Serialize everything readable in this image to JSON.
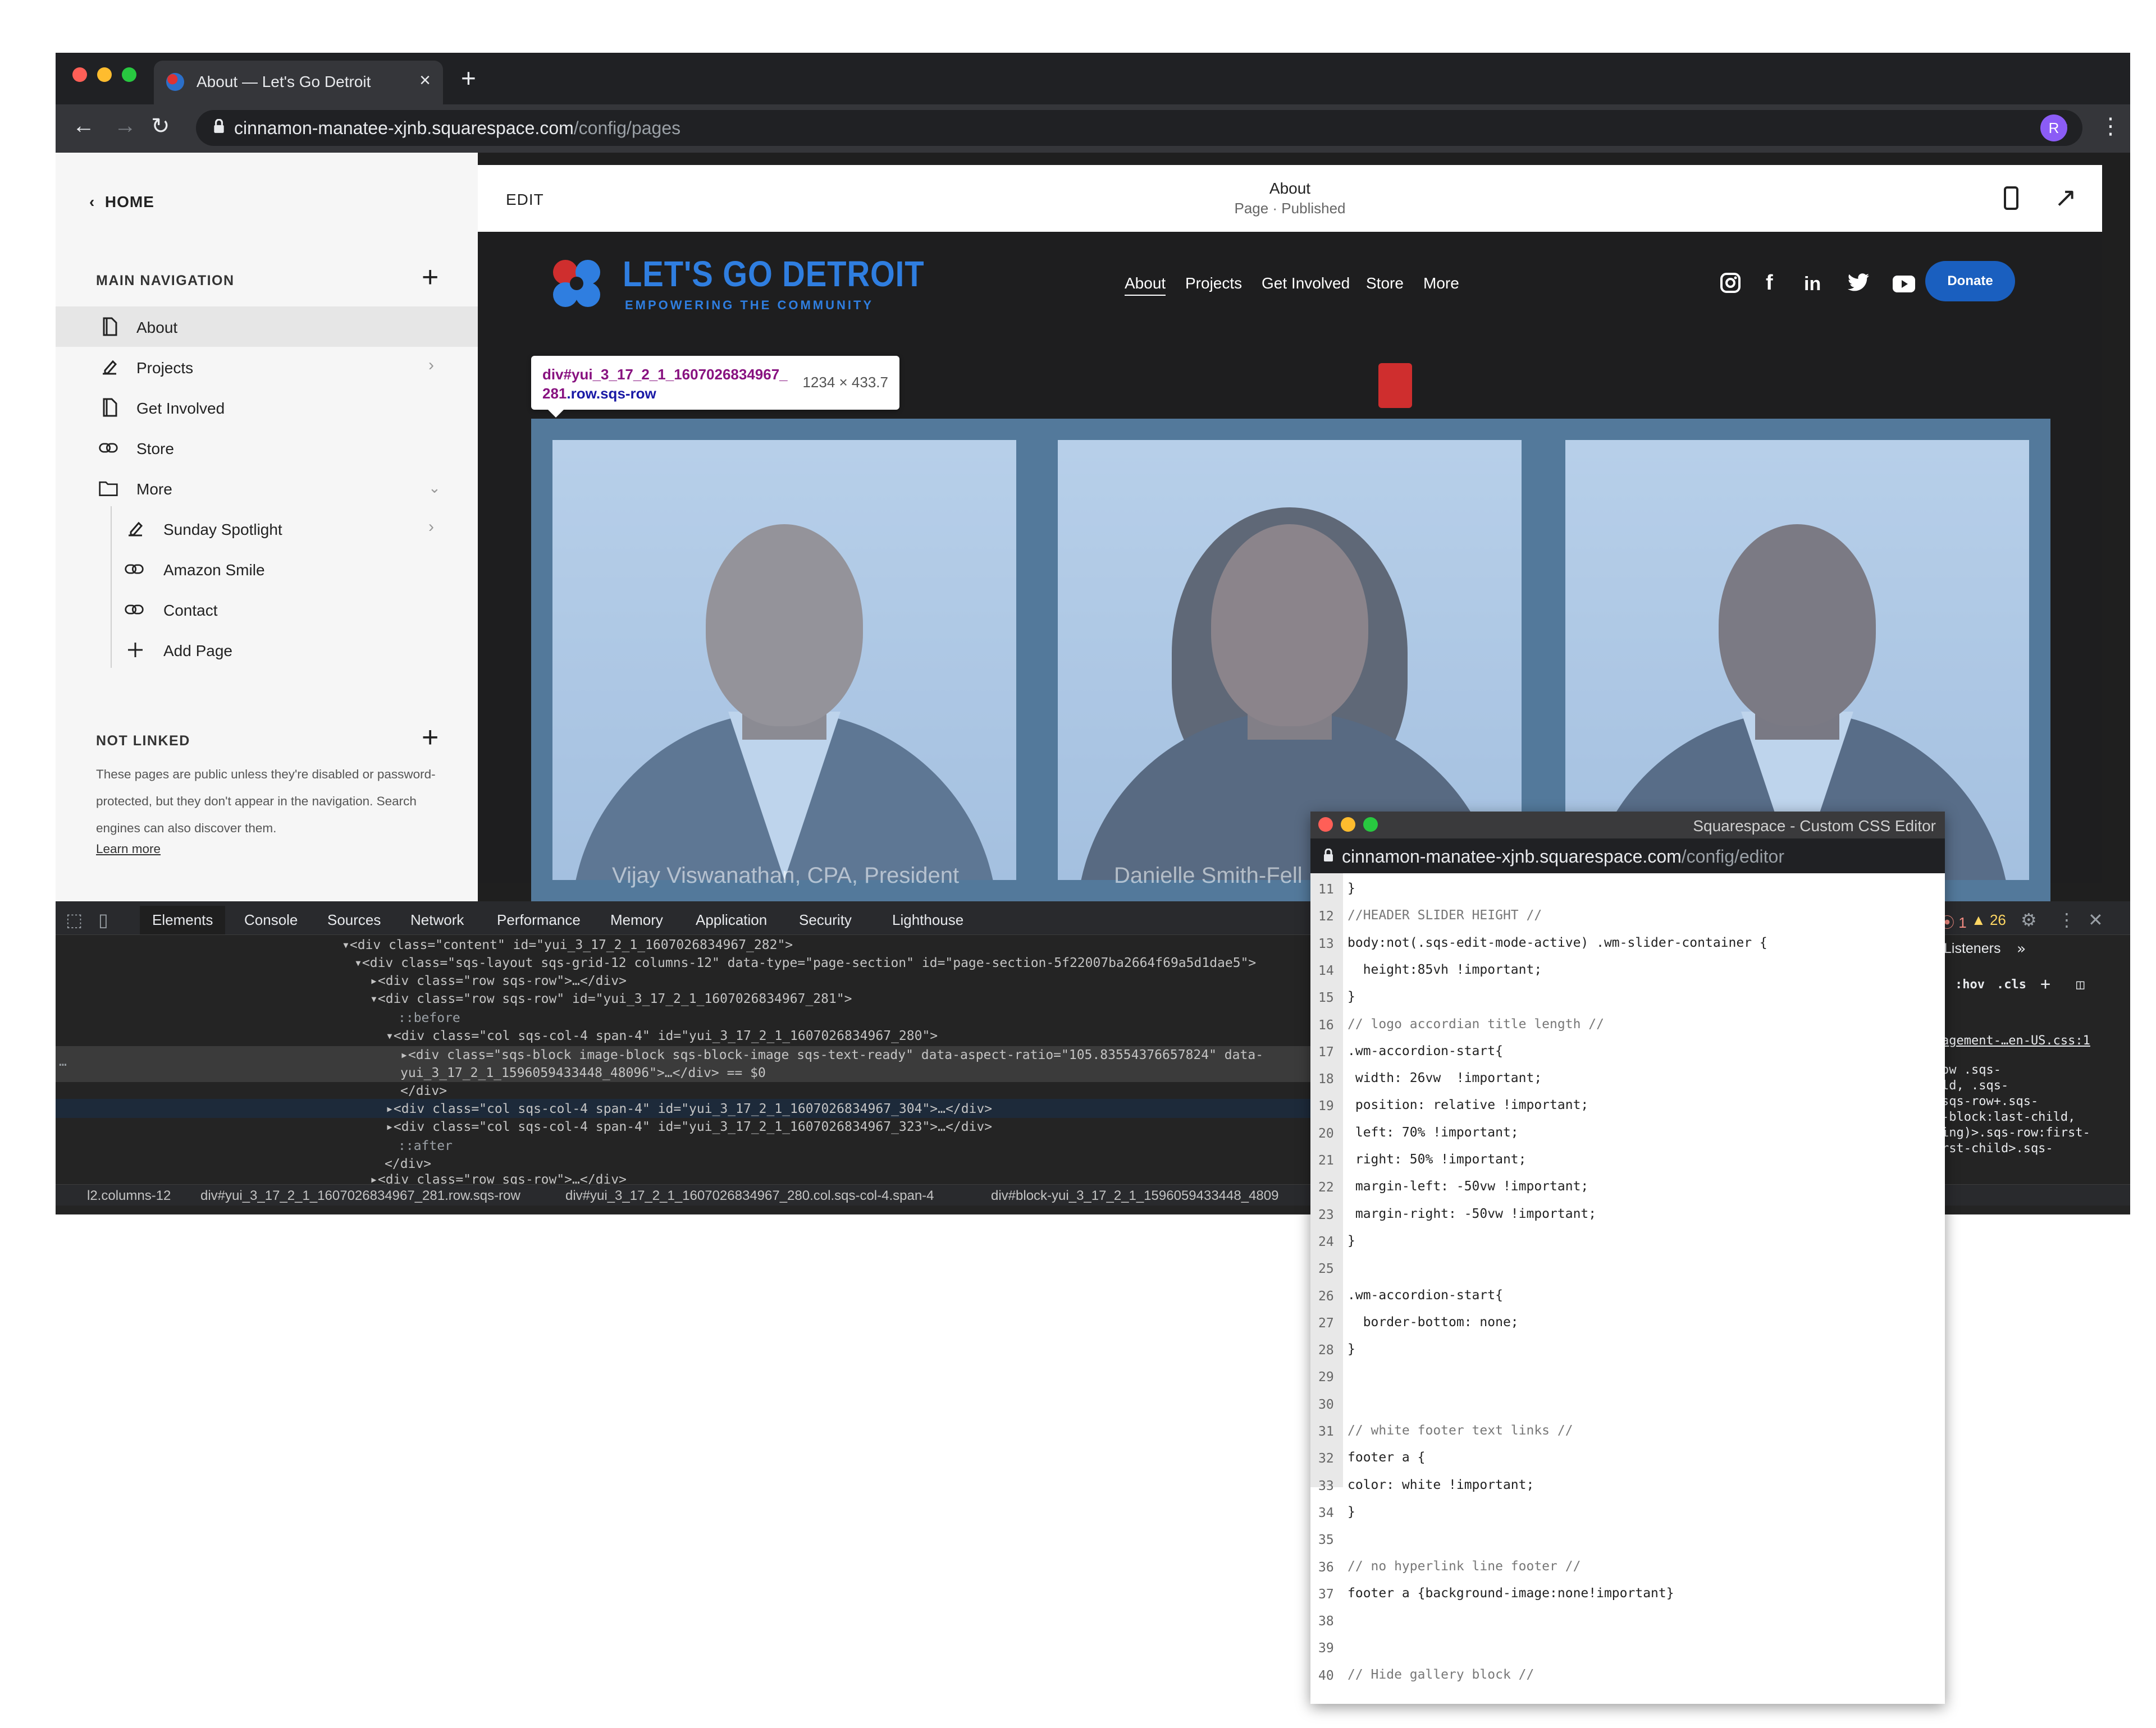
{
  "browser": {
    "tab_title": "About — Let's Go Detroit",
    "url_host": "cinnamon-manatee-xjnb.squarespace.com",
    "url_path": "/config/pages",
    "profile_initial": "R",
    "traffic_lights": [
      "#ff5f57",
      "#febc2e",
      "#28c840"
    ]
  },
  "sidebar": {
    "home_label": "HOME",
    "main_nav_title": "MAIN NAVIGATION",
    "items": [
      {
        "label": "About",
        "icon": "page-icon",
        "active": true
      },
      {
        "label": "Projects",
        "icon": "blog-pen-icon",
        "chevron": true
      },
      {
        "label": "Get Involved",
        "icon": "page-icon"
      },
      {
        "label": "Store",
        "icon": "link-icon"
      },
      {
        "label": "More",
        "icon": "folder-icon",
        "expanded": true
      },
      {
        "label": "Sunday Spotlight",
        "icon": "blog-pen-icon",
        "chevron": true
      },
      {
        "label": "Amazon Smile",
        "icon": "link-icon"
      },
      {
        "label": "Contact",
        "icon": "link-icon"
      },
      {
        "label": "Add Page",
        "icon": "plus-icon"
      }
    ],
    "not_linked_title": "NOT LINKED",
    "not_linked_desc": "These pages are public unless they're disabled or password-protected, but they don't appear in the navigation. Search engines can also discover them.",
    "learn_more": "Learn more"
  },
  "editor": {
    "edit_label": "EDIT",
    "page_name": "About",
    "page_status": "Page · Published"
  },
  "site": {
    "logo_text": "LET'S GO DETROIT",
    "tagline": "EMPOWERING THE COMMUNITY",
    "nav": [
      "About",
      "Projects",
      "Get Involved",
      "Store",
      "More"
    ],
    "social_icons": [
      "instagram-icon",
      "facebook-icon",
      "linkedin-icon",
      "twitter-icon",
      "youtube-icon"
    ],
    "donate_label": "Donate",
    "brand_color": "#2f7ee0",
    "captions": [
      "Vijay Viswanathan, CPA, President",
      "Danielle Smith-Fell"
    ]
  },
  "inspector_tooltip": {
    "selector_tag": "div#yui_3_17_2_1_1607026834967_281",
    "selector_class": ".row.sqs-row",
    "dimensions": "1234 × 433.7"
  },
  "devtools": {
    "tabs": [
      "Elements",
      "Console",
      "Sources",
      "Network",
      "Performance",
      "Memory",
      "Application",
      "Security",
      "Lighthouse"
    ],
    "active_tab": "Elements",
    "error_count": "1",
    "warning_count": "26",
    "dom_lines": [
      {
        "html": "▾<div class=\"content\" id=\"yui_3_17_2_1_1607026834967_282\">"
      },
      {
        "html": "▾<div class=\"sqs-layout sqs-grid-12 columns-12\" data-type=\"page-section\" id=\"page-section-5f22007ba2664f69a5d1dae5\">"
      },
      {
        "html": "▸<div class=\"row sqs-row\">…</div>"
      },
      {
        "html": "▾<div class=\"row sqs-row\" id=\"yui_3_17_2_1_1607026834967_281\">"
      },
      {
        "html": "::before"
      },
      {
        "html": "▾<div class=\"col sqs-col-4 span-4\" id=\"yui_3_17_2_1_1607026834967_280\">"
      },
      {
        "html": "▸<div class=\"sqs-block image-block sqs-block-image sqs-text-ready\" data-aspect-ratio=\"105.83554376657824\" data-"
      },
      {
        "html": "yui_3_17_2_1_1596059433448_48096\">…</div> == $0"
      },
      {
        "html": "</div>"
      },
      {
        "html": "▸<div class=\"col sqs-col-4 span-4\" id=\"yui_3_17_2_1_1607026834967_304\">…</div>"
      },
      {
        "html": "▸<div class=\"col sqs-col-4 span-4\" id=\"yui_3_17_2_1_1607026834967_323\">…</div>"
      },
      {
        "html": "::after"
      },
      {
        "html": "</div>"
      },
      {
        "html": "▸<div class=\"row sqs-row\">…</div>"
      }
    ],
    "breadcrumbs": [
      "l2.columns-12",
      "div#yui_3_17_2_1_1607026834967_281.row.sqs-row",
      "div#yui_3_17_2_1_1607026834967_280.col.sqs-col-4.span-4",
      "div#block-yui_3_17_2_1_1596059433448_4809"
    ],
    "right_panel": {
      "listeners_tab": "Listeners",
      "hov": ":hov",
      "cls": ".cls",
      "source_link": "agement-…en-US.css:1",
      "snippet": [
        "ow .sqs-",
        "ld, .sqs-",
        "sqs-row+.sqs-",
        "-block:last-child,",
        "ing)>.sqs-row:first-",
        "rst-child>.sqs-"
      ]
    }
  },
  "css_editor": {
    "window_title": "Squarespace - Custom CSS Editor",
    "url_host": "cinnamon-manatee-xjnb.squarespace.com",
    "url_path": "/config/editor",
    "lines": [
      {
        "n": "11",
        "t": "}"
      },
      {
        "n": "12",
        "t": "//HEADER SLIDER HEIGHT //"
      },
      {
        "n": "13",
        "t": "body:not(.sqs-edit-mode-active) .wm-slider-container {"
      },
      {
        "n": "14",
        "t": "  height:85vh !important;"
      },
      {
        "n": "15",
        "t": "}"
      },
      {
        "n": "16",
        "t": "// logo accordian title length //"
      },
      {
        "n": "17",
        "t": ".wm-accordion-start{"
      },
      {
        "n": "18",
        "t": " width: 26vw  !important;"
      },
      {
        "n": "19",
        "t": " position: relative !important;"
      },
      {
        "n": "20",
        "t": " left: 70% !important;"
      },
      {
        "n": "21",
        "t": " right: 50% !important;"
      },
      {
        "n": "22",
        "t": " margin-left: -50vw !important;"
      },
      {
        "n": "23",
        "t": " margin-right: -50vw !important;"
      },
      {
        "n": "24",
        "t": "}"
      },
      {
        "n": "25",
        "t": ""
      },
      {
        "n": "26",
        "t": ".wm-accordion-start{"
      },
      {
        "n": "27",
        "t": "  border-bottom: none;"
      },
      {
        "n": "28",
        "t": "}"
      },
      {
        "n": "29",
        "t": ""
      },
      {
        "n": "30",
        "t": ""
      },
      {
        "n": "31",
        "t": "// white footer text links //"
      },
      {
        "n": "32",
        "t": "footer a {"
      },
      {
        "n": "33",
        "t": "color: white !important;"
      },
      {
        "n": "34",
        "t": "}"
      },
      {
        "n": "35",
        "t": ""
      },
      {
        "n": "36",
        "t": "// no hyperlink line footer //"
      },
      {
        "n": "37",
        "t": "footer a {background-image:none!important}"
      },
      {
        "n": "38",
        "t": ""
      },
      {
        "n": "39",
        "t": ""
      },
      {
        "n": "40",
        "t": "// Hide gallery block //"
      }
    ]
  }
}
